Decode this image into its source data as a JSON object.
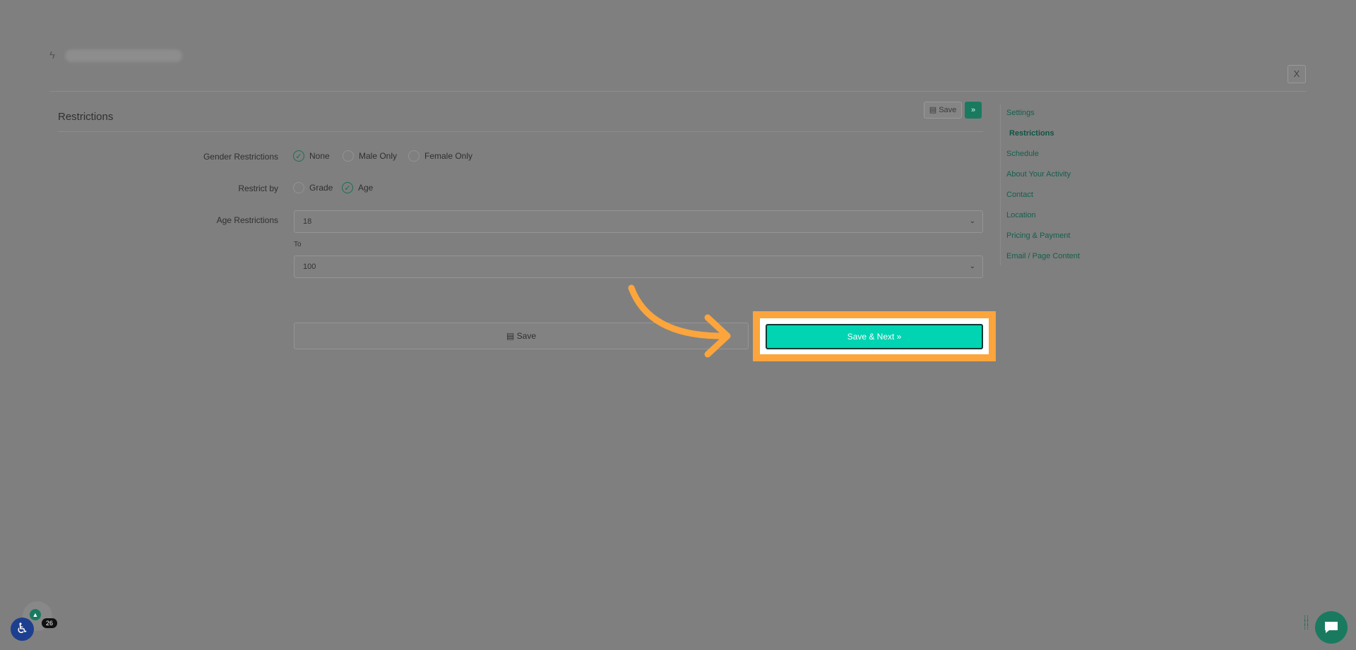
{
  "header": {
    "close_label": "X"
  },
  "section": {
    "title": "Restrictions",
    "top_save_label": "Save",
    "top_next_label": "»"
  },
  "form": {
    "gender": {
      "label": "Gender Restrictions",
      "options": [
        {
          "label": "None",
          "selected": true
        },
        {
          "label": "Male Only",
          "selected": false
        },
        {
          "label": "Female Only",
          "selected": false
        }
      ]
    },
    "restrict_by": {
      "label": "Restrict by",
      "options": [
        {
          "label": "Grade",
          "selected": false
        },
        {
          "label": "Age",
          "selected": true
        }
      ]
    },
    "age": {
      "label": "Age Restrictions",
      "min_value": "18",
      "to_label": "To",
      "max_value": "100"
    }
  },
  "actions": {
    "save_label": "Save",
    "save_next_label": "Save & Next »"
  },
  "sidebar": {
    "items": [
      {
        "label": "Settings",
        "active": false
      },
      {
        "label": "Restrictions",
        "active": true
      },
      {
        "label": "Schedule",
        "active": false
      },
      {
        "label": "About Your Activity",
        "active": false
      },
      {
        "label": "Contact",
        "active": false
      },
      {
        "label": "Location",
        "active": false
      },
      {
        "label": "Pricing & Payment",
        "active": false
      },
      {
        "label": "Email / Page Content",
        "active": false
      }
    ]
  },
  "widgets": {
    "badge_count": "26"
  },
  "colors": {
    "overlay": "#7f7f7f",
    "brand_green": "#1a7a60",
    "highlight_orange": "#fba53c",
    "primary_button": "#00d4b2"
  }
}
